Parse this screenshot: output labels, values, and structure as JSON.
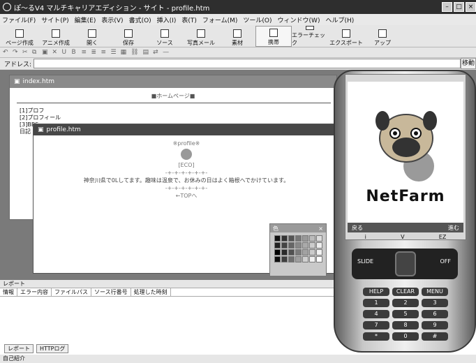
{
  "window": {
    "title": "ぽ〜るV4 マルチキャリアエディション - サイト - profile.htm"
  },
  "menu": [
    "ファイル(F)",
    "サイト(P)",
    "編集(E)",
    "表示(V)",
    "書式(O)",
    "挿入(I)",
    "表(T)",
    "フォーム(M)",
    "ツール(O)",
    "ウィンドウ(W)",
    "ヘルプ(H)"
  ],
  "toolbar": [
    {
      "label": "ページ作成"
    },
    {
      "label": "アニメ作成"
    },
    {
      "label": "開く"
    },
    {
      "label": "保存"
    },
    {
      "label": "ソース"
    },
    {
      "label": "写真メール"
    },
    {
      "label": "素材"
    },
    {
      "label": "携帯"
    },
    {
      "label": "エラーチェック"
    },
    {
      "label": "エクスポート"
    },
    {
      "label": "アップ"
    }
  ],
  "address": {
    "label": "アドレス:",
    "go": "移動"
  },
  "windows": {
    "index": {
      "title": "index.htm",
      "heading": "■ホームページ■",
      "links": [
        "[1]プロフ",
        "[2]プロフィール",
        "[3]BBS"
      ],
      "extra": "日記"
    },
    "profile": {
      "title": "profile.htm",
      "heading": "※profile※",
      "name": "[ECO]",
      "line": "-+-+-+-+-+-+-",
      "intro": "神奈川県で0Lしてます。趣味は温泉で、お休みの日はよく箱根へでかけています。",
      "back": "←TOPへ"
    }
  },
  "palette": {
    "title": "色",
    "close": "×"
  },
  "report": {
    "title": "レポート",
    "columns": [
      "情報",
      "エラー内容",
      "ファイルパス",
      "ソース行番号",
      "処理した時刻"
    ],
    "tabs": [
      "レポート",
      "HTTPログ"
    ]
  },
  "status": {
    "text": "自己紹介"
  },
  "phone": {
    "softkeys": {
      "left": "戻る",
      "right": "進む"
    },
    "keys_row": [
      "i",
      "V",
      "EZ"
    ],
    "slide": "SLIDE",
    "off": "OFF",
    "keypad": [
      "HELP",
      "CLEAR",
      "MENU",
      "1",
      "2",
      "3",
      "4",
      "5",
      "6",
      "7",
      "8",
      "9",
      "*",
      "0",
      "#"
    ],
    "brand": "NetFarm"
  },
  "palette_colors": [
    "#111111",
    "#333333",
    "#555555",
    "#777777",
    "#999999",
    "#bbbbbb",
    "#dddddd",
    "#222222",
    "#444444",
    "#666666",
    "#888888",
    "#aaaaaa",
    "#cccccc",
    "#eeeeee",
    "#000000",
    "#2a2a2a",
    "#525252",
    "#7a7a7a",
    "#a2a2a2",
    "#cacaca",
    "#f2f2f2",
    "#0f0f0f",
    "#3f3f3f",
    "#6f6f6f",
    "#9f9f9f",
    "#cfcfcf",
    "#efefef",
    "#ffffff"
  ]
}
